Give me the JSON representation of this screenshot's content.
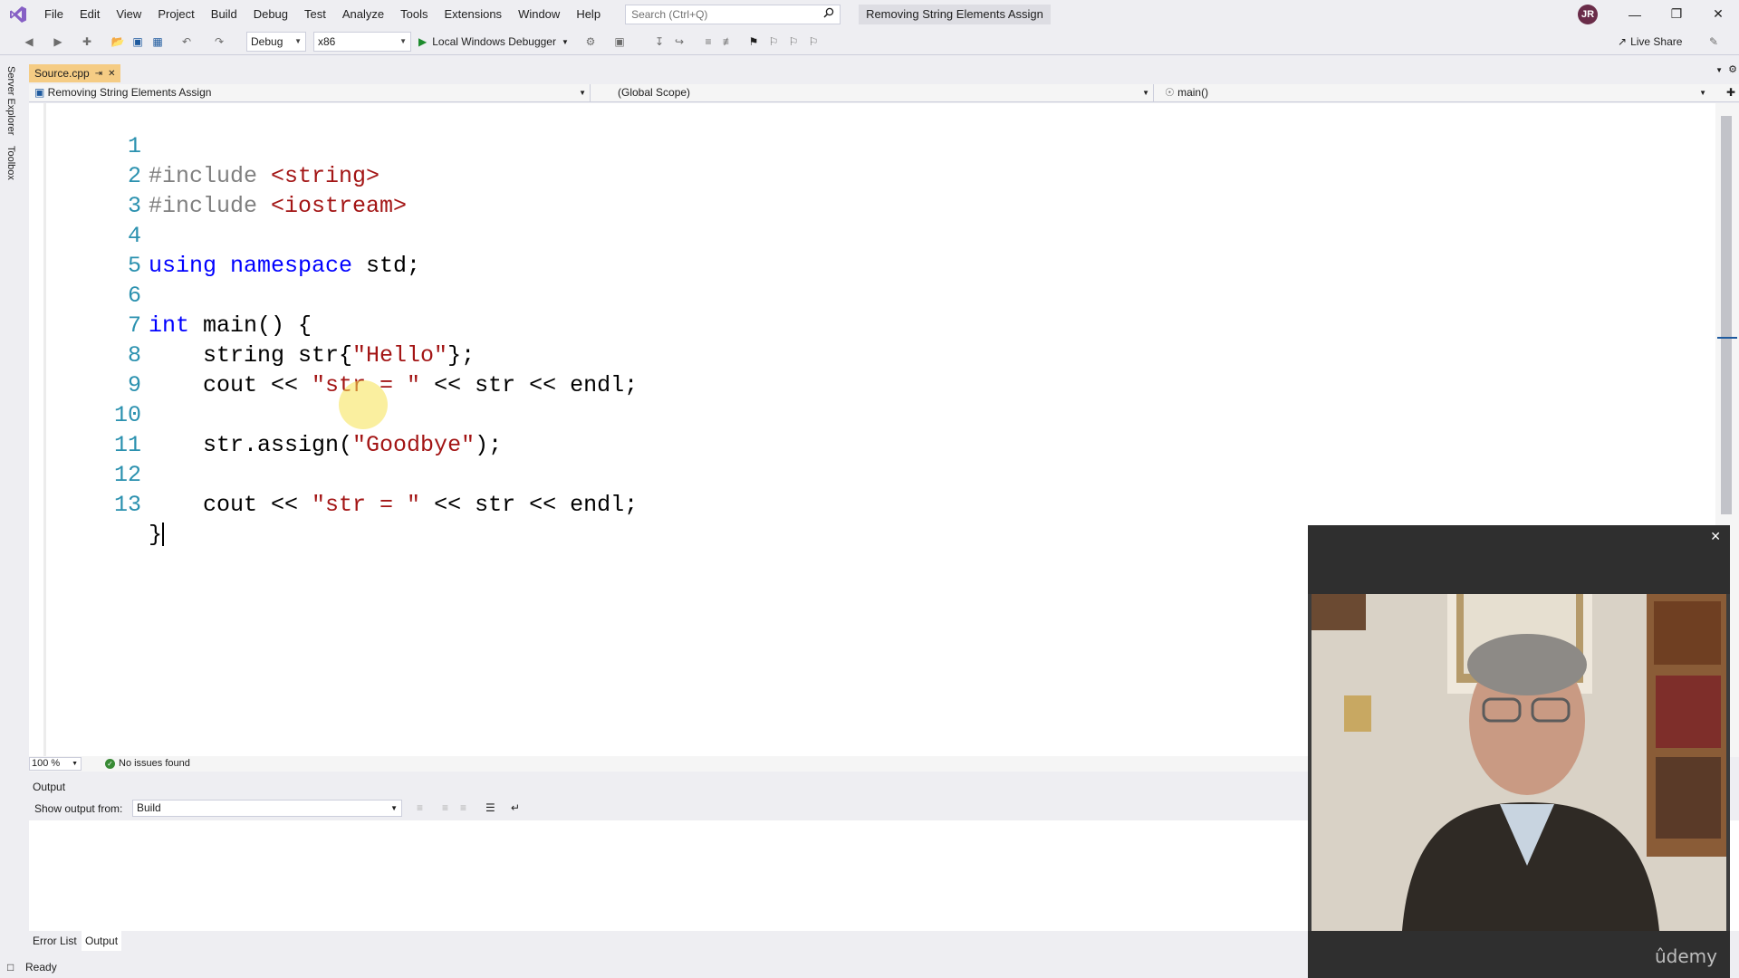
{
  "menu": {
    "items": [
      "File",
      "Edit",
      "View",
      "Project",
      "Build",
      "Debug",
      "Test",
      "Analyze",
      "Tools",
      "Extensions",
      "Window",
      "Help"
    ],
    "search_placeholder": "Search (Ctrl+Q)",
    "solution_title": "Removing String Elements Assign",
    "user_initials": "JR"
  },
  "toolbar": {
    "config": "Debug",
    "platform": "x86",
    "debugger": "Local Windows Debugger",
    "live_share": "Live Share"
  },
  "left_rail": {
    "server_explorer": "Server Explorer",
    "toolbox": "Toolbox"
  },
  "document": {
    "tab_name": "Source.cpp",
    "tab_pin": "⇥",
    "close": "✕"
  },
  "navbar": {
    "project": "Removing String Elements Assign",
    "scope": "(Global Scope)",
    "member": "main()"
  },
  "code_lines": [
    {
      "n": "1"
    },
    {
      "n": "2"
    },
    {
      "n": "3"
    },
    {
      "n": "4"
    },
    {
      "n": "5"
    },
    {
      "n": "6"
    },
    {
      "n": "7"
    },
    {
      "n": "8"
    },
    {
      "n": "9"
    },
    {
      "n": "10"
    },
    {
      "n": "11"
    },
    {
      "n": "12"
    },
    {
      "n": "13"
    }
  ],
  "code": {
    "l1_directive": "#include",
    "l1_header": " <string>",
    "l2_directive": "#include",
    "l2_header": " <iostream>",
    "l4_using": "using",
    "l4_namespace": " namespace",
    "l4_rest": " std;",
    "l6_int": "int",
    "l6_rest": " main() {",
    "l7_pre": "    string str{",
    "l7_str": "\"Hello\"",
    "l7_post": "};",
    "l8_pre": "    cout << ",
    "l8_str": "\"str = \"",
    "l8_post": " << str << endl;",
    "l10_pre": "    str.assign(",
    "l10_str": "\"Goodbye\"",
    "l10_post": ");",
    "l12_pre": "    cout << ",
    "l12_str": "\"str = \"",
    "l12_post": " << str << endl;",
    "l13": "}"
  },
  "editor_status": {
    "zoom": "100 %",
    "issues": "No issues found"
  },
  "output": {
    "title": "Output",
    "show_from_label": "Show output from:",
    "show_from_value": "Build"
  },
  "bottom_tabs": [
    "Error List",
    "Output"
  ],
  "status": {
    "text": "Ready"
  },
  "webcam": {
    "close": "✕",
    "brand": "ûdemy"
  },
  "colors": {
    "accent": "#68217a",
    "tab_active": "#f5cc84",
    "keyword": "#0000ff",
    "string": "#a31515",
    "line_number": "#2b91af"
  }
}
